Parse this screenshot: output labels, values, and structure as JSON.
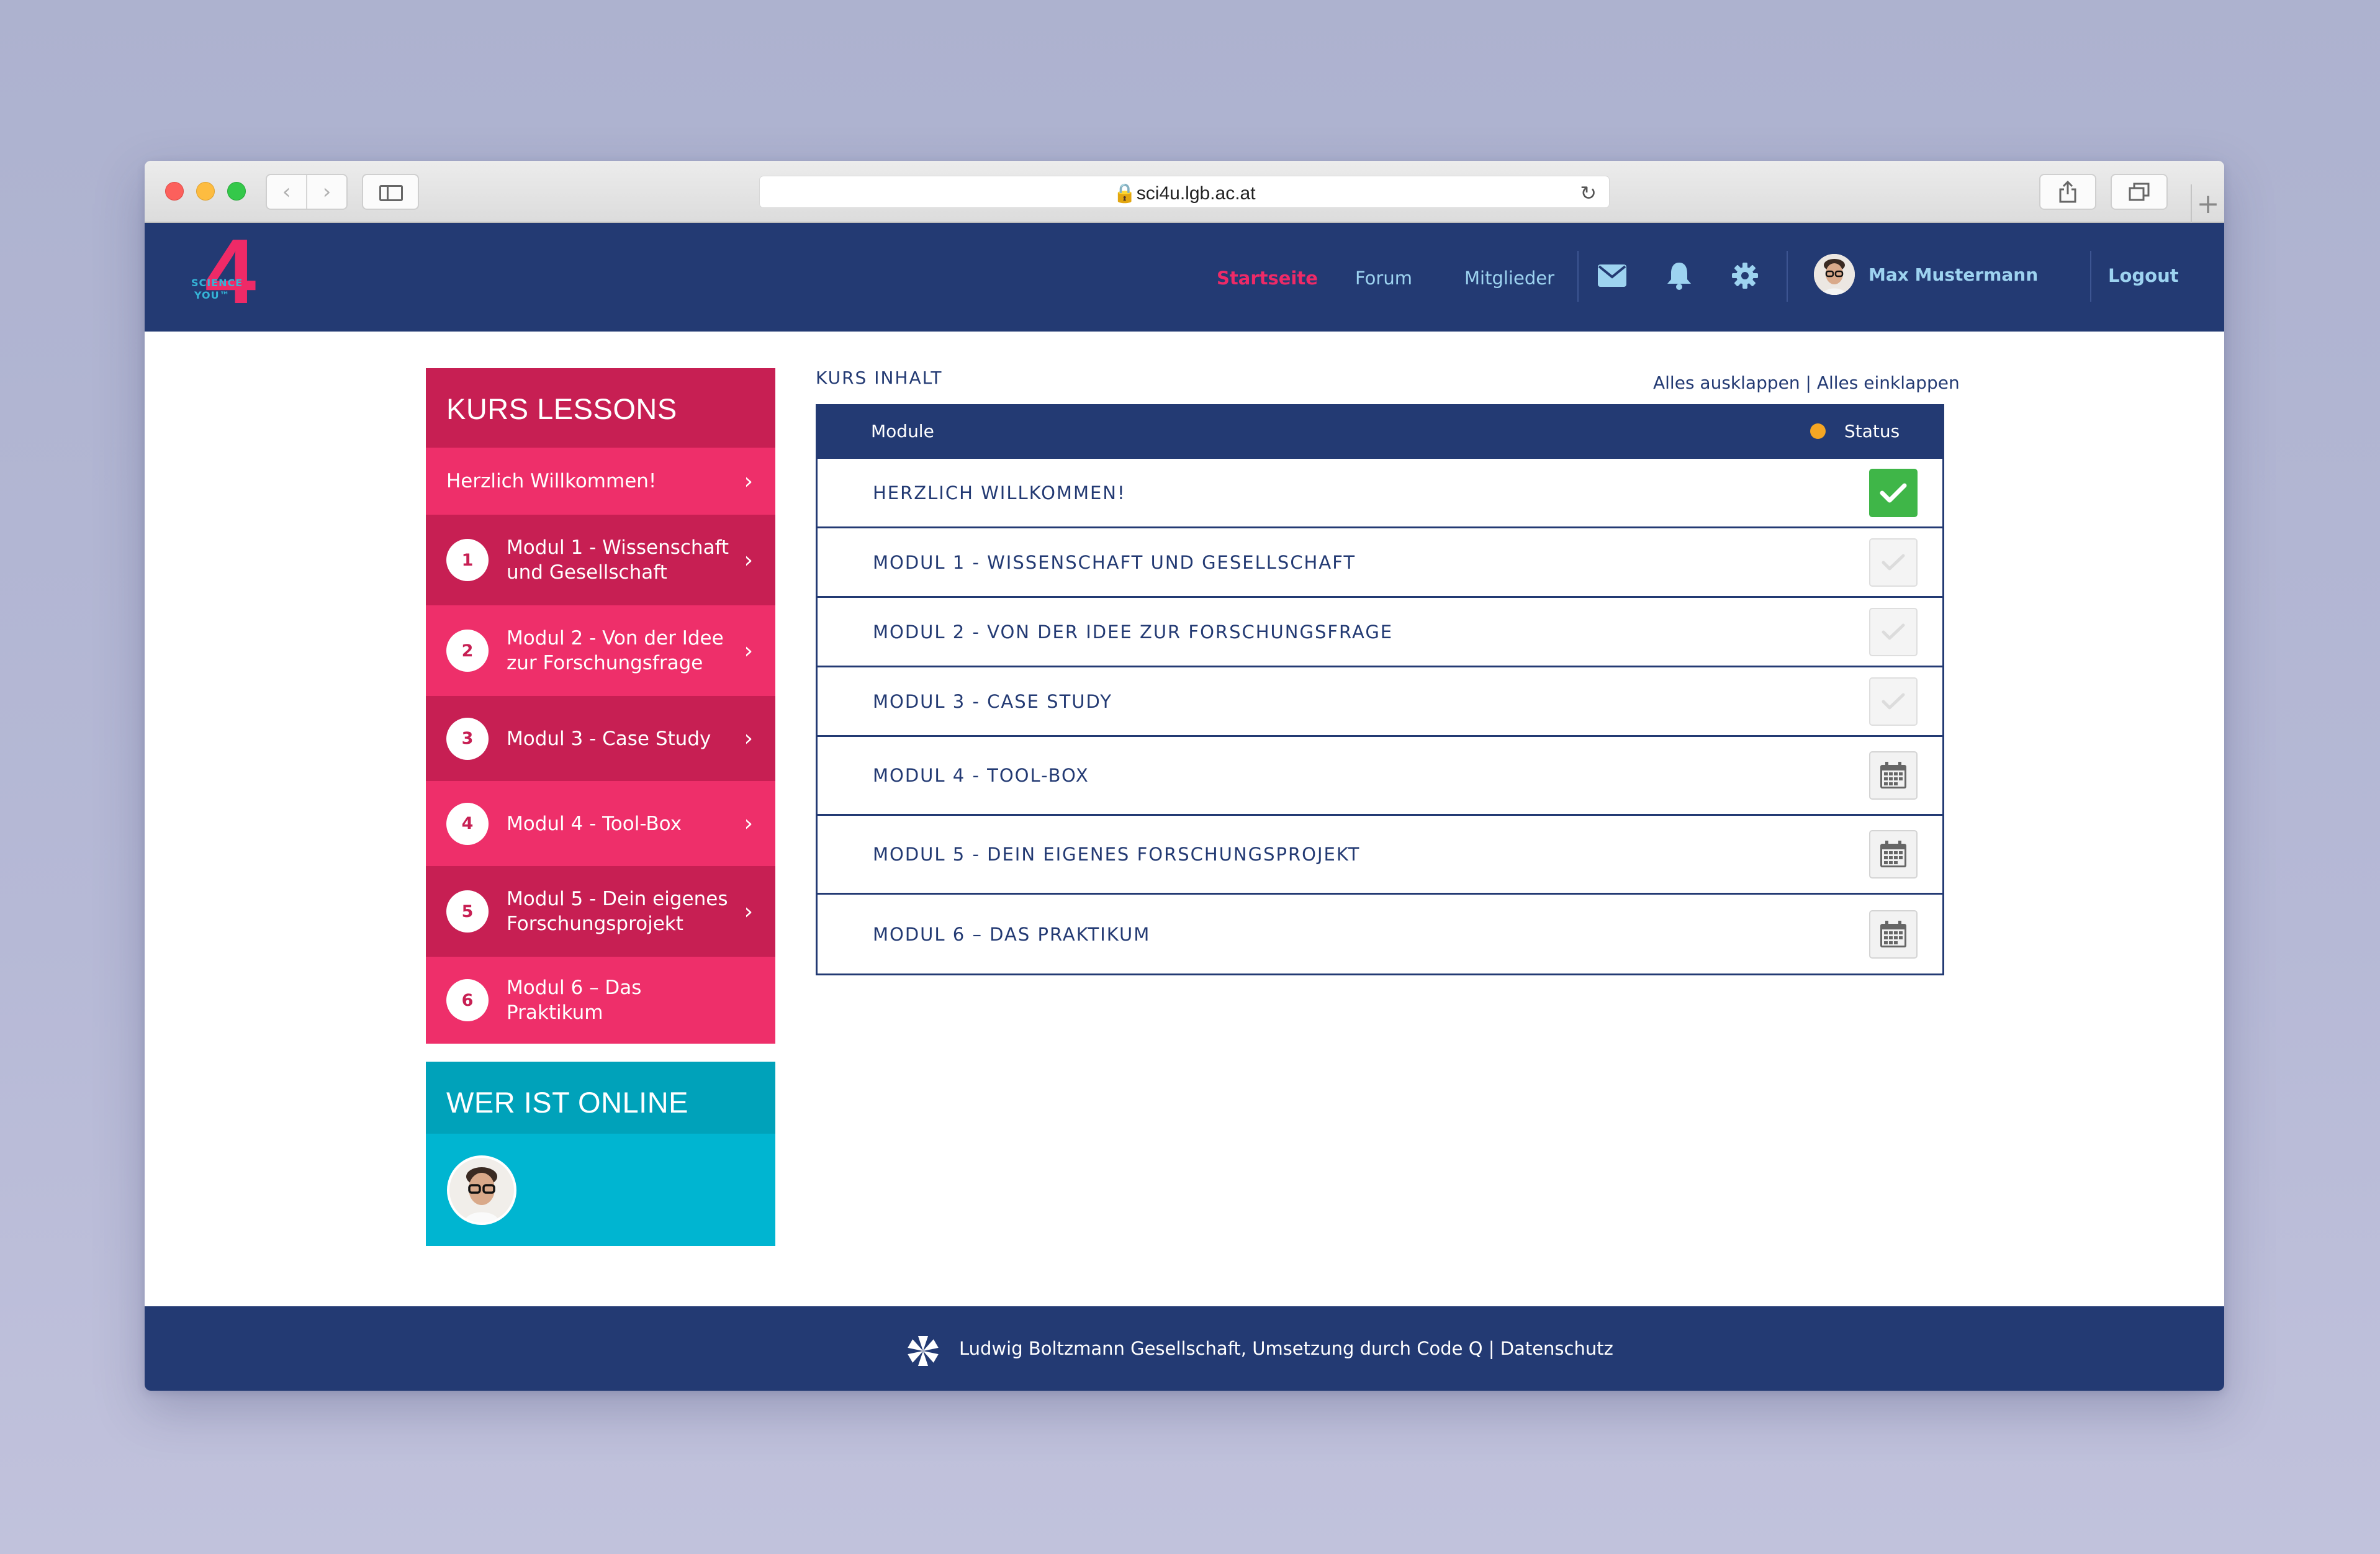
{
  "browser": {
    "url": "sci4u.lgb.ac.at"
  },
  "header": {
    "logo": {
      "line1": "SCIENCE",
      "line2": "YOU™",
      "numeral": "4"
    },
    "nav": [
      "Startseite",
      "Forum",
      "Mitglieder"
    ],
    "active_nav": "Startseite",
    "icons": [
      "mail-icon",
      "bell-icon",
      "gear-icon"
    ],
    "user_name": "Max Mustermann",
    "logout_label": "Logout"
  },
  "sidebar": {
    "lessons_title": "KURS LESSONS",
    "lessons": [
      {
        "number": "",
        "label": "Herzlich Willkommen!"
      },
      {
        "number": "1",
        "label": "Modul 1 - Wissenschaft und Gesellschaft"
      },
      {
        "number": "2",
        "label": "Modul 2 - Von der Idee zur Forschungsfrage"
      },
      {
        "number": "3",
        "label": "Modul 3 - Case Study"
      },
      {
        "number": "4",
        "label": "Modul 4 - Tool-Box"
      },
      {
        "number": "5",
        "label": "Modul 5 - Dein eigenes Forschungsprojekt"
      },
      {
        "number": "6",
        "label": "Modul 6 – Das Praktikum"
      }
    ],
    "online_title": "WER IST ONLINE"
  },
  "content": {
    "section_label": "KURS INHALT",
    "expand_all": "Alles ausklappen",
    "separator": "|",
    "collapse_all": "Alles einklappen",
    "columns": {
      "module": "Module",
      "status": "Status"
    },
    "modules": [
      {
        "title": "HERZLICH WILLKOMMEN!",
        "status": "completed"
      },
      {
        "title": "MODUL 1 - WISSENSCHAFT UND GESELLSCHAFT",
        "status": "open"
      },
      {
        "title": "MODUL 2 - VON DER IDEE ZUR FORSCHUNGSFRAGE",
        "status": "open"
      },
      {
        "title": "MODUL 3 - CASE STUDY",
        "status": "open"
      },
      {
        "title": "MODUL 4 - TOOL-BOX",
        "status": "scheduled"
      },
      {
        "title": "MODUL 5 - DEIN EIGENES FORSCHUNGSPROJEKT",
        "status": "scheduled"
      },
      {
        "title": "MODUL 6 – DAS PRAKTIKUM",
        "status": "scheduled"
      }
    ]
  },
  "footer": {
    "text": "Ludwig Boltzmann Gesellschaft, Umsetzung durch Code Q | Datenschutz"
  },
  "colors": {
    "navy": "#233a73",
    "pink": "#ee2f6a",
    "pink_dark": "#c71f53",
    "cyan": "#00b5d1",
    "green": "#3fb648",
    "orange": "#f5a623",
    "nav_link": "#9dd3f0"
  }
}
